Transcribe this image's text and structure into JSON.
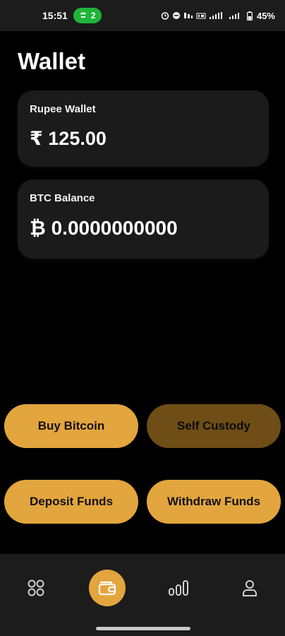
{
  "status_bar": {
    "time": "15:51",
    "call_count": "2",
    "battery": "45%"
  },
  "page": {
    "title": "Wallet"
  },
  "cards": {
    "rupee": {
      "label": "Rupee Wallet",
      "value": "₹ 125.00"
    },
    "btc": {
      "label": "BTC Balance",
      "value": "₿ 0.0000000000"
    }
  },
  "actions": {
    "buy": "Buy Bitcoin",
    "custody": "Self Custody",
    "deposit": "Deposit Funds",
    "withdraw": "Withdraw Funds"
  },
  "nav": {
    "items": [
      {
        "icon": "apps-grid-icon"
      },
      {
        "icon": "wallet-icon",
        "active": true
      },
      {
        "icon": "stats-icon"
      },
      {
        "icon": "profile-icon"
      }
    ]
  },
  "colors": {
    "accent": "#e3a53d",
    "accent_muted": "#6e4d16",
    "card_bg": "#1b1b1b",
    "call_green": "#1fb43a"
  }
}
